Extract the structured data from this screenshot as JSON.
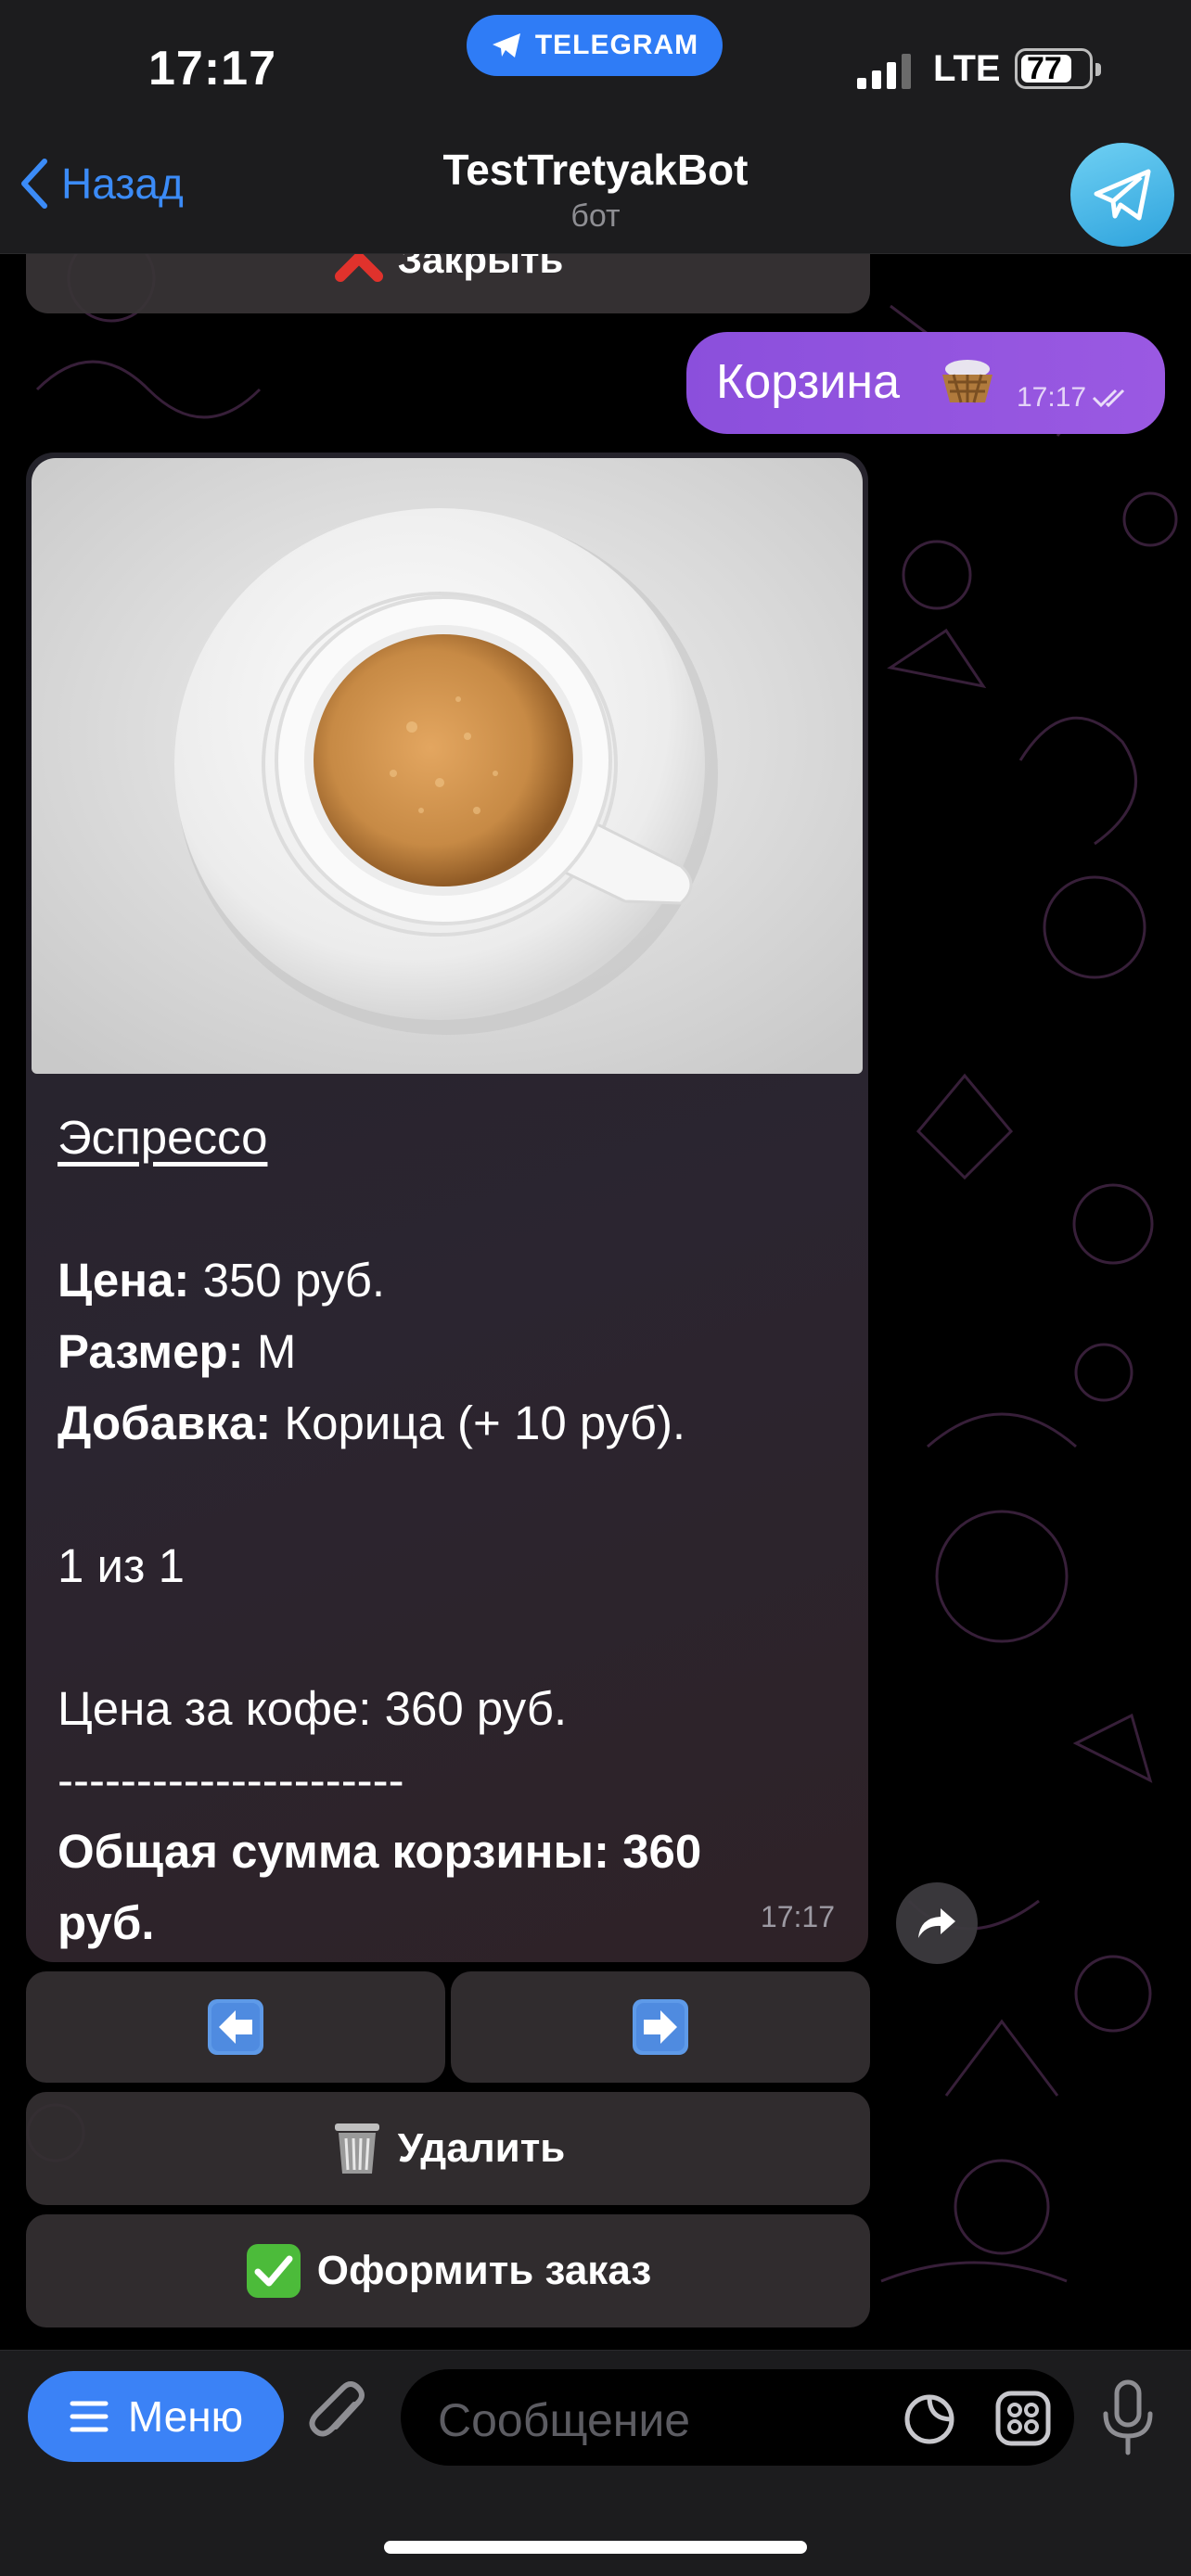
{
  "status_bar": {
    "time": "17:17",
    "app_pill": "TELEGRAM",
    "network": "LTE",
    "battery": "77",
    "battery_level": 0.77
  },
  "nav": {
    "back_label": "Назад",
    "title": "TestTretyakBot",
    "subtitle": "бот",
    "avatar_icon": "telegram-plane-icon"
  },
  "prev_keyboard": {
    "close_label": "Закрыть",
    "close_icon": "red-cross-icon"
  },
  "outgoing": {
    "text": "Корзина",
    "emoji_icon": "basket-icon",
    "time": "17:17",
    "status_icon": "double-check-icon"
  },
  "card": {
    "image_icon": "espresso-cup-photo",
    "title": "Эспрессо",
    "price_label": "Цена:",
    "price_value": "350 руб.",
    "size_label": "Размер:",
    "size_value": "M",
    "addon_label": "Добавка:",
    "addon_value": "Корица (+ 10 руб).",
    "position": "1 из 1",
    "coffee_price": "Цена за кофе: 360 руб.",
    "divider": "----------------------",
    "total_line1": "Общая сумма корзины: 360",
    "total_line2": "руб.",
    "time": "17:17"
  },
  "keyboard": {
    "prev_icon": "left-arrow-icon",
    "next_icon": "right-arrow-icon",
    "delete_label": "Удалить",
    "delete_icon": "wastebasket-icon",
    "checkout_label": "Оформить заказ",
    "checkout_icon": "check-mark-icon"
  },
  "input_bar": {
    "menu_label": "Меню",
    "placeholder": "Сообщение"
  },
  "colors": {
    "accent": "#3b82f6",
    "outgoing_bubble": "#9256de",
    "bar_bg": "#1c1c1e"
  }
}
